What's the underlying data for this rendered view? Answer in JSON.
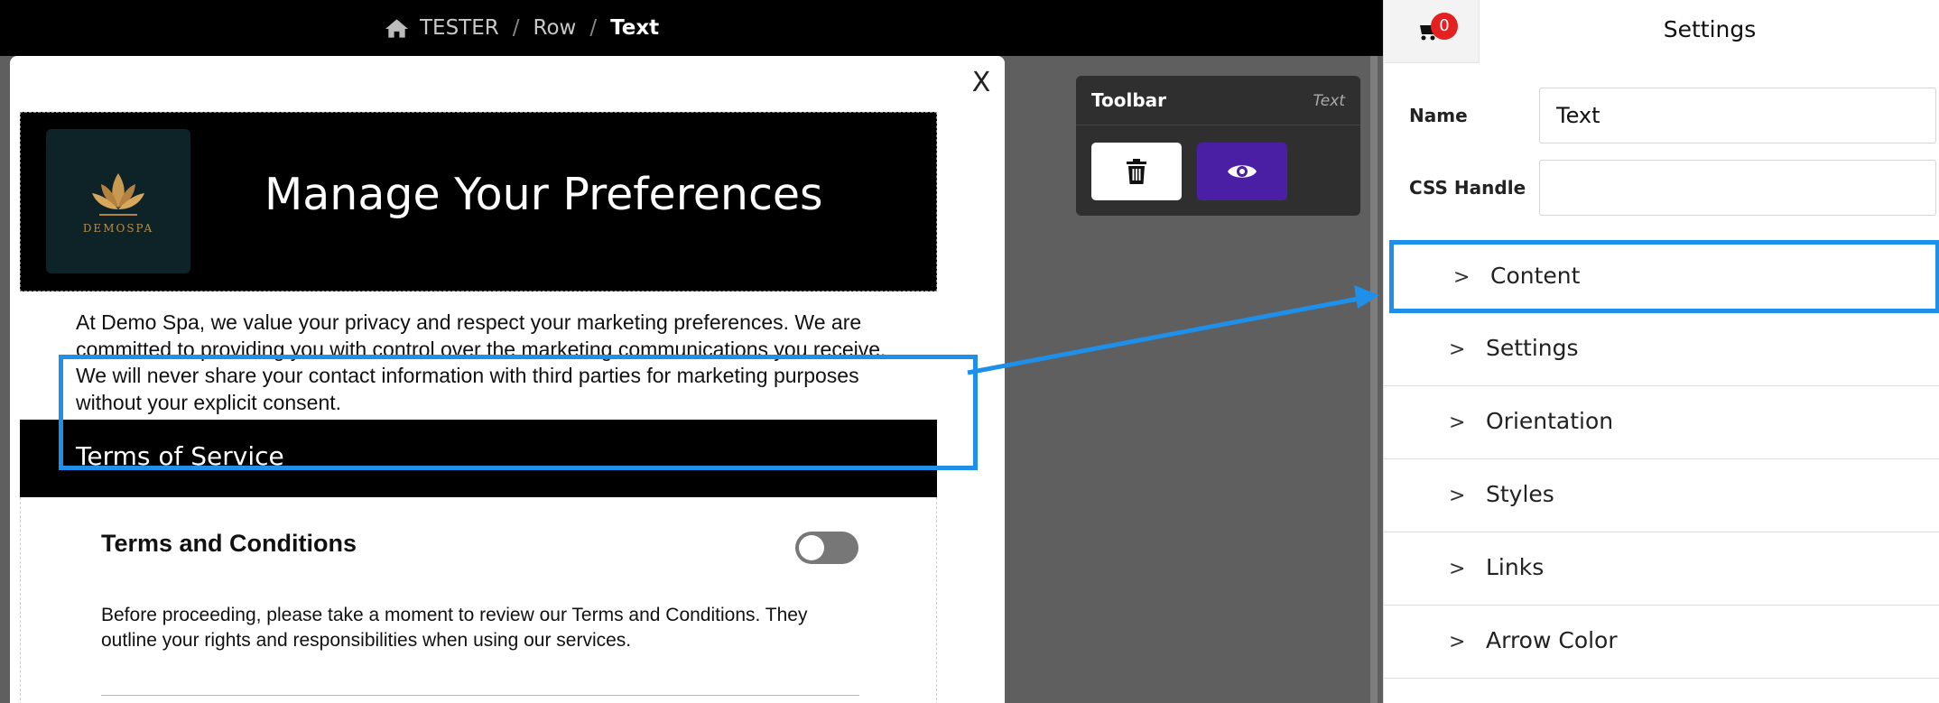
{
  "breadcrumb": {
    "items": [
      "TESTER",
      "Row",
      "Text"
    ],
    "separator": "/"
  },
  "modal": {
    "close_label": "X"
  },
  "email": {
    "hero_title": "Manage Your Preferences",
    "logo_text": "DEMOSPA",
    "intro_text": "At Demo Spa, we value your privacy and respect your marketing preferences. We are committed to providing you with control over the marketing communications you receive. We will never share your contact information with third parties for marketing purposes without your explicit consent.",
    "section_title": "Terms of Service",
    "terms_title": "Terms and Conditions",
    "terms_body": "Before proceeding, please take a moment to review our Terms and Conditions. They outline your rights and responsibilities when using our services."
  },
  "toolbar": {
    "title": "Toolbar",
    "tag": "Text"
  },
  "panel": {
    "cart_count": "0",
    "title": "Settings",
    "name_label": "Name",
    "name_value": "Text",
    "css_label": "CSS Handle",
    "css_value": "",
    "sections": [
      "Content",
      "Settings",
      "Orientation",
      "Styles",
      "Links",
      "Arrow Color"
    ]
  },
  "colors": {
    "highlight": "#1e90ea",
    "view_button": "#4b1fa3",
    "badge": "#e52020"
  },
  "icons": [
    "home-icon",
    "trash-icon",
    "eye-icon",
    "cart-icon",
    "chevron-right-icon"
  ]
}
